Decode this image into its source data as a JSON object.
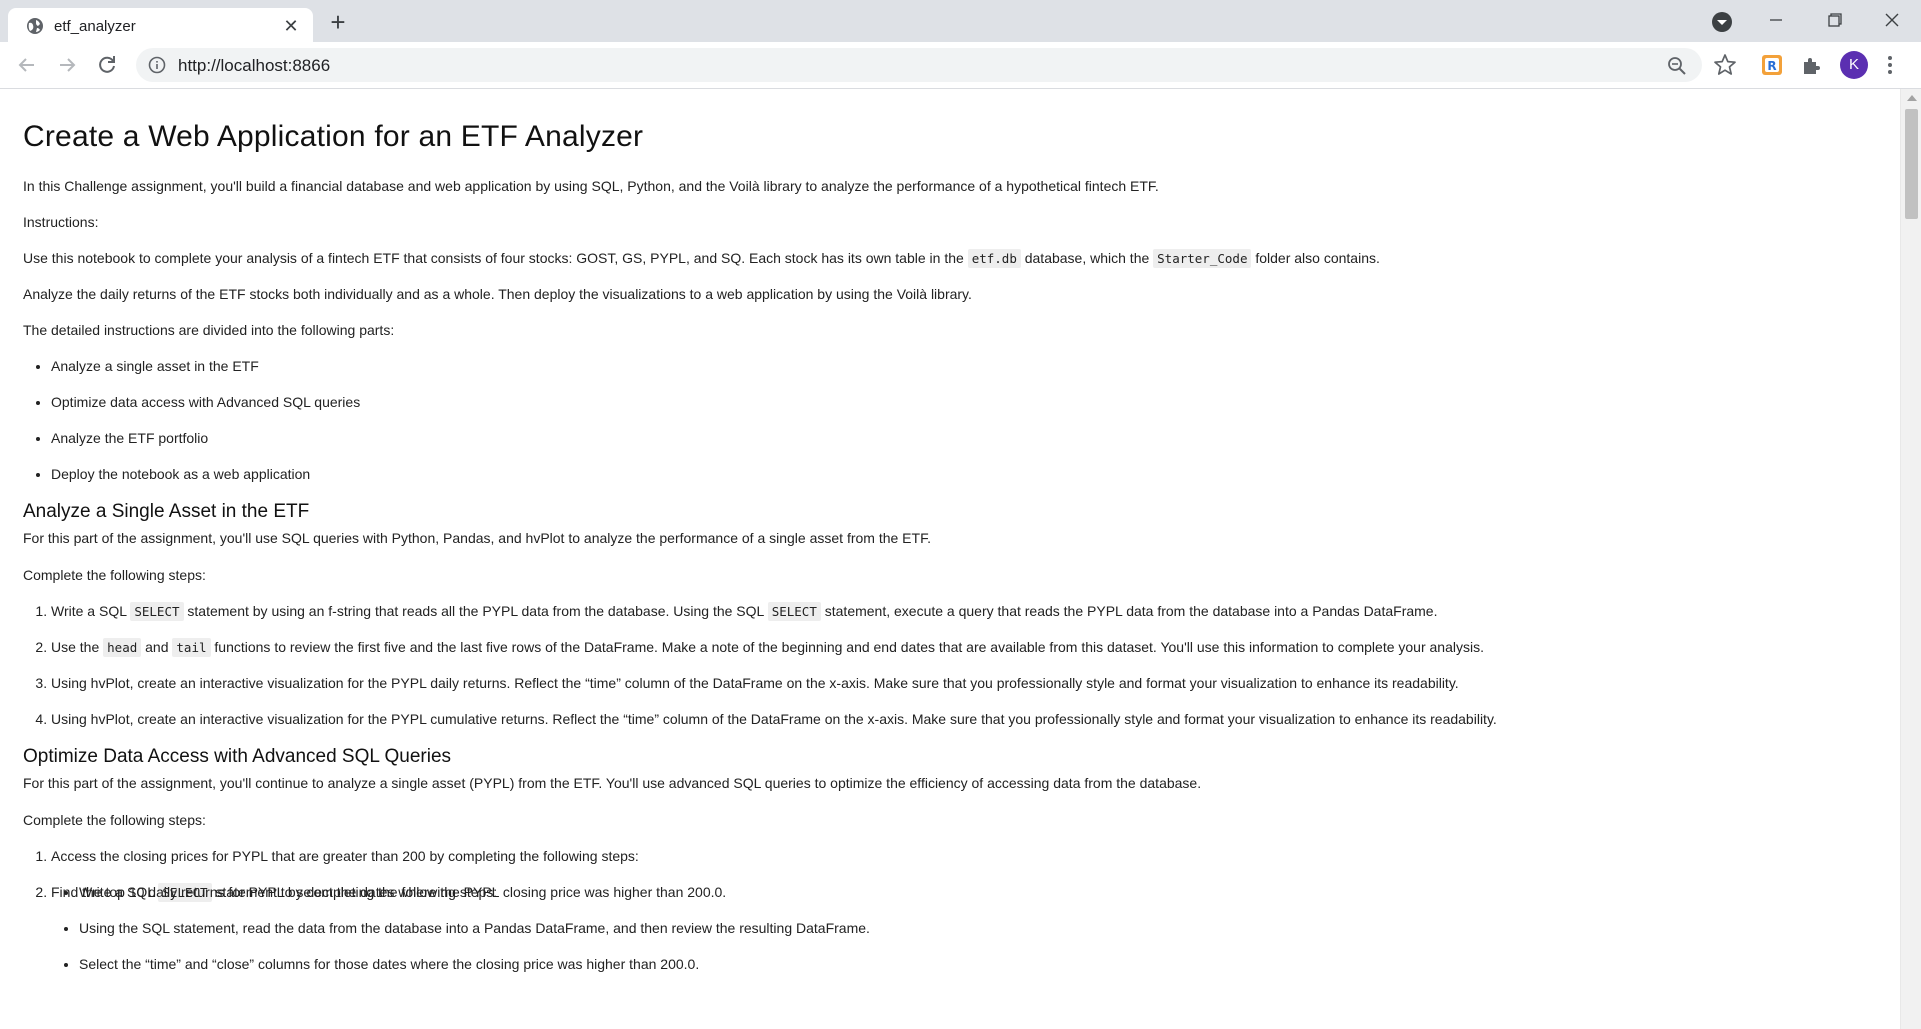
{
  "browser": {
    "tab_title": "etf_analyzer",
    "url": "http://localhost:8866",
    "profile_initial": "K"
  },
  "page": {
    "title": "Create a Web Application for an ETF Analyzer",
    "intro": "In this Challenge assignment, you'll build a financial database and web application by using SQL, Python, and the Voilà library to analyze the performance of a hypothetical fintech ETF.",
    "instructions_label": "Instructions:",
    "use_notebook": {
      "a": "Use this notebook to complete your analysis of a fintech ETF that consists of four stocks: GOST, GS, PYPL, and SQ. Each stock has its own table in the",
      "code1": "etf.db",
      "b": "database, which the",
      "code2": "Starter_Code",
      "c": "folder also contains."
    },
    "analyze_daily": "Analyze the daily returns of the ETF stocks both individually and as a whole. Then deploy the visualizations to a web application by using the Voilà library.",
    "parts_label": "The detailed instructions are divided into the following parts:",
    "parts": [
      "Analyze a single asset in the ETF",
      "Optimize data access with Advanced SQL queries",
      "Analyze the ETF portfolio",
      "Deploy the notebook as a web application"
    ],
    "section1": {
      "heading": "Analyze a Single Asset in the ETF",
      "desc": "For this part of the assignment, you'll use SQL queries with Python, Pandas, and hvPlot to analyze the performance of a single asset from the ETF.",
      "steps_label": "Complete the following steps:",
      "step1": {
        "a": "Write a SQL",
        "code1": "SELECT",
        "b": "statement by using an f-string that reads all the PYPL data from the database. Using the SQL",
        "code2": "SELECT",
        "c": "statement, execute a query that reads the PYPL data from the database into a Pandas DataFrame."
      },
      "step2": {
        "a": "Use the",
        "code1": "head",
        "b": "and",
        "code2": "tail",
        "c": "functions to review the first five and the last five rows of the DataFrame. Make a note of the beginning and end dates that are available from this dataset. You'll use this information to complete your analysis."
      },
      "step3": "Using hvPlot, create an interactive visualization for the PYPL daily returns. Reflect the “time” column of the DataFrame on the x-axis. Make sure that you professionally style and format your visualization to enhance its readability.",
      "step4": "Using hvPlot, create an interactive visualization for the PYPL cumulative returns. Reflect the “time” column of the DataFrame on the x-axis. Make sure that you professionally style and format your visualization to enhance its readability."
    },
    "section2": {
      "heading": "Optimize Data Access with Advanced SQL Queries",
      "desc": "For this part of the assignment, you'll continue to analyze a single asset (PYPL) from the ETF. You'll use advanced SQL queries to optimize the efficiency of accessing data from the database.",
      "steps_label": "Complete the following steps:",
      "step1": "Access the closing prices for PYPL that are greater than 200 by completing the following steps:",
      "step1_sub1": {
        "a": "Write a SQL",
        "code": "SELECT",
        "b": "statement to select the dates where the PYPL closing price was higher than 200.0."
      },
      "step1_sub2": "Using the SQL statement, read the data from the database into a Pandas DataFrame, and then review the resulting DataFrame.",
      "step1_sub3": "Select the “time” and “close” columns for those dates where the closing price was higher than 200.0.",
      "step2": "Find the top 10 daily returns for PYPL by completing the following steps:"
    }
  }
}
